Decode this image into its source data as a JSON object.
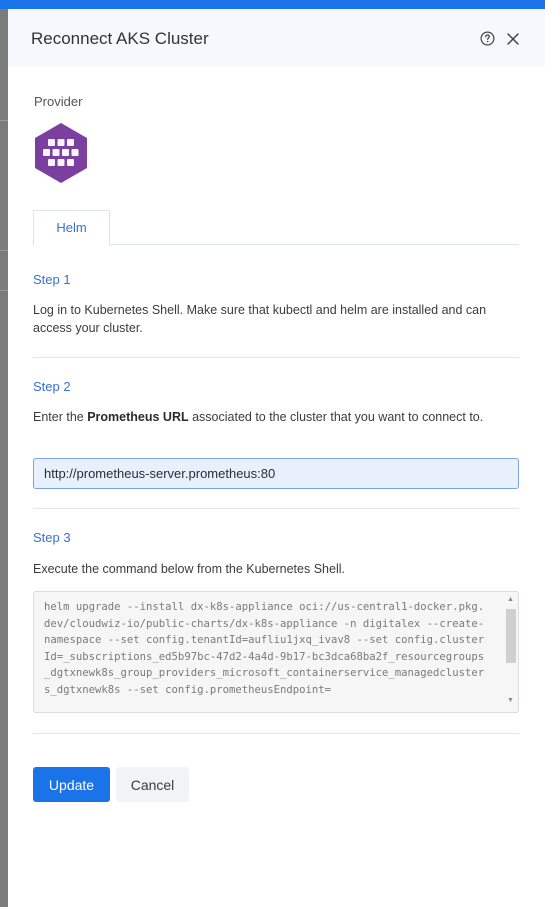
{
  "dialog": {
    "title": "Reconnect AKS Cluster",
    "help_icon": "question-circle-icon",
    "close_icon": "close-x-icon"
  },
  "provider": {
    "label": "Provider",
    "logo_icon": "aks-hexagon-logo-icon",
    "logo_color": "#7b3fa0"
  },
  "tabs": [
    {
      "label": "Helm",
      "active": true
    }
  ],
  "step1": {
    "title": "Step 1",
    "text": "Log in to Kubernetes Shell. Make sure that kubectl and helm are installed and can access your cluster."
  },
  "step2": {
    "title": "Step 2",
    "text_before": "Enter the ",
    "text_bold": "Prometheus URL",
    "text_after": " associated to the cluster that you want to connect to.",
    "url_value": "http://prometheus-server.prometheus:80"
  },
  "step3": {
    "title": "Step 3",
    "text": "Execute the command below from the Kubernetes Shell.",
    "command": "helm upgrade --install dx-k8s-appliance oci://us-central1-docker.pkg.dev/cloudwiz-io/public-charts/dx-k8s-appliance -n digitalex --create-namespace --set config.tenantId=aufliu1jxq_ivav8 --set config.clusterId=_subscriptions_ed5b97bc-47d2-4a4d-9b17-bc3dca68ba2f_resourcegroups_dgtxnewk8s_group_providers_microsoft_containerservice_managedclusters_dgtxnewk8s --set config.prometheusEndpoint="
  },
  "actions": {
    "update_label": "Update",
    "cancel_label": "Cancel"
  },
  "colors": {
    "accent": "#1a73e8",
    "step_title": "#3a6fd8",
    "header_bg": "#f5f8fd"
  }
}
